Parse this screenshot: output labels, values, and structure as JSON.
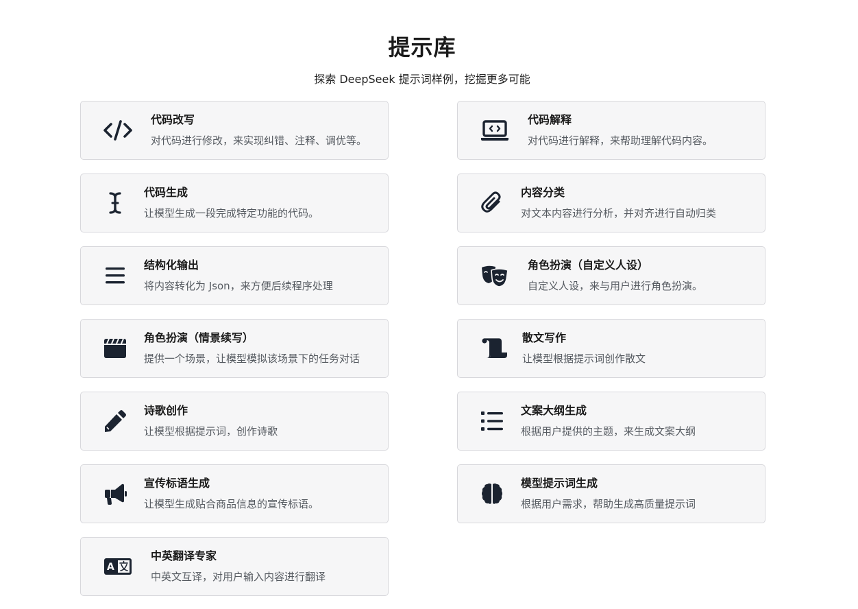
{
  "header": {
    "title": "提示库",
    "subtitle": "探索 DeepSeek 提示词样例，挖掘更多可能"
  },
  "cards": [
    {
      "icon": "code-icon",
      "title": "代码改写",
      "desc": "对代码进行修改，来实现纠错、注释、调优等。"
    },
    {
      "icon": "laptop-code-icon",
      "title": "代码解释",
      "desc": "对代码进行解释，来帮助理解代码内容。"
    },
    {
      "icon": "text-cursor-icon",
      "title": "代码生成",
      "desc": "让模型生成一段完成特定功能的代码。"
    },
    {
      "icon": "paperclip-icon",
      "title": "内容分类",
      "desc": "对文本内容进行分析，并对齐进行自动归类"
    },
    {
      "icon": "menu-lines-icon",
      "title": "结构化输出",
      "desc": "将内容转化为 Json，来方便后续程序处理"
    },
    {
      "icon": "theater-masks-icon",
      "title": "角色扮演（自定义人设）",
      "desc": "自定义人设，来与用户进行角色扮演。"
    },
    {
      "icon": "clapperboard-icon",
      "title": "角色扮演（情景续写）",
      "desc": "提供一个场景，让模型模拟该场景下的任务对话"
    },
    {
      "icon": "scroll-icon",
      "title": "散文写作",
      "desc": "让模型根据提示词创作散文"
    },
    {
      "icon": "pencil-icon",
      "title": "诗歌创作",
      "desc": "让模型根据提示词，创作诗歌"
    },
    {
      "icon": "list-icon",
      "title": "文案大纲生成",
      "desc": "根据用户提供的主题，来生成文案大纲"
    },
    {
      "icon": "megaphone-icon",
      "title": "宣传标语生成",
      "desc": "让模型生成贴合商品信息的宣传标语。"
    },
    {
      "icon": "brain-icon",
      "title": "模型提示词生成",
      "desc": "根据用户需求，帮助生成高质量提示词"
    },
    {
      "icon": "translate-icon",
      "title": "中英翻译专家",
      "desc": "中英文互译，对用户输入内容进行翻译"
    }
  ]
}
